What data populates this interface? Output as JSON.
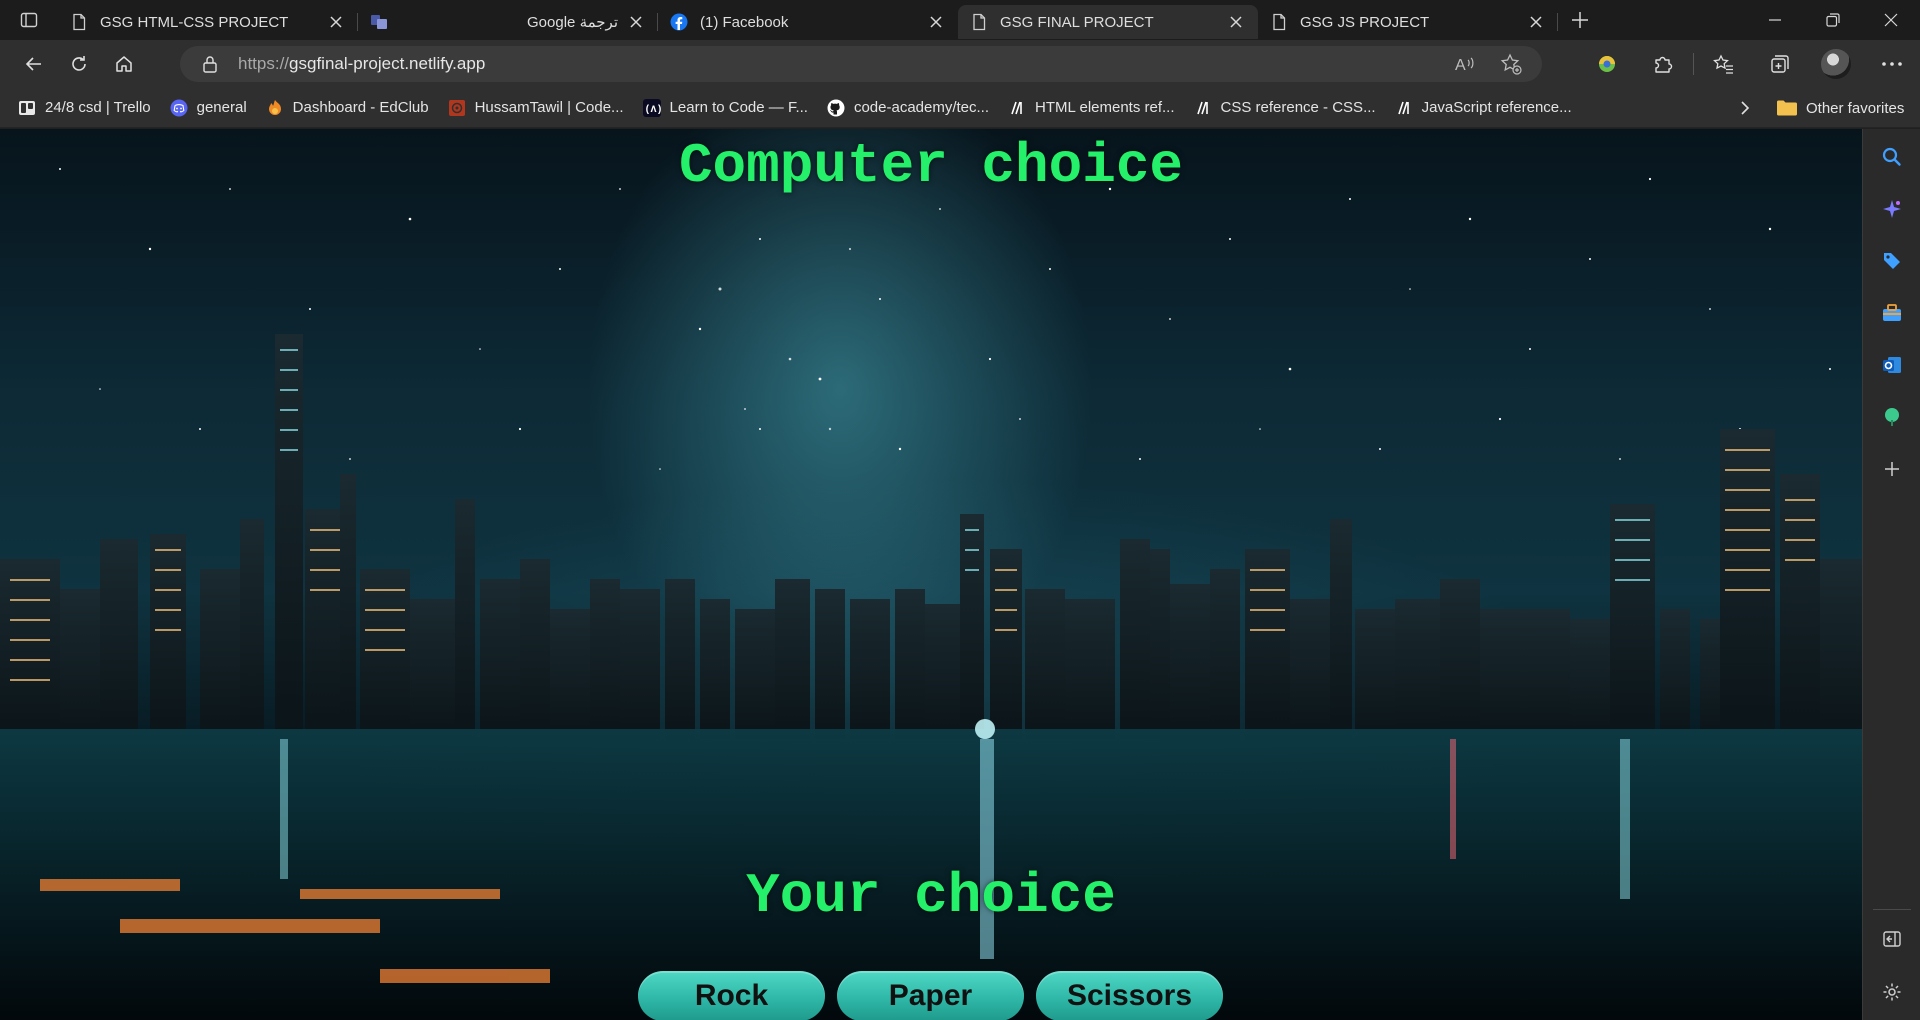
{
  "browser": {
    "tabs": [
      {
        "title": "GSG HTML-CSS PROJECT",
        "icon": "page-icon",
        "active": false
      },
      {
        "title": "Google ترجمة",
        "icon": "translate-icon",
        "active": false
      },
      {
        "title": "(1) Facebook",
        "icon": "facebook-icon",
        "active": false
      },
      {
        "title": "GSG FINAL PROJECT",
        "icon": "page-icon",
        "active": true
      },
      {
        "title": "GSG JS PROJECT",
        "icon": "page-icon",
        "active": false
      }
    ],
    "address": {
      "scheme": "https://",
      "host": "gsgfinal-project.netlify.app"
    },
    "favorites": [
      {
        "label": "24/8 csd | Trello",
        "icon": "trello-icon",
        "color": "#e8e8e8"
      },
      {
        "label": "general",
        "icon": "discord-icon",
        "color": "#5865f2"
      },
      {
        "label": "Dashboard - EdClub",
        "icon": "edclub-icon",
        "color": "#f08a24"
      },
      {
        "label": "HussamTawil | Code...",
        "icon": "codewars-icon",
        "color": "#b1361e"
      },
      {
        "label": "Learn to Code — F...",
        "icon": "freecodecamp-icon",
        "color": "#ffffff"
      },
      {
        "label": "code-academy/tec...",
        "icon": "github-icon",
        "color": "#ffffff"
      },
      {
        "label": "HTML elements ref...",
        "icon": "mdn-icon",
        "color": "#ffffff"
      },
      {
        "label": "CSS reference - CSS...",
        "icon": "mdn-icon",
        "color": "#ffffff"
      },
      {
        "label": "JavaScript reference...",
        "icon": "mdn-icon",
        "color": "#ffffff"
      }
    ],
    "other_favorites": "Other favorites"
  },
  "page": {
    "computer_heading": "Computer choice",
    "your_heading": "Your choice",
    "choices": [
      "Rock",
      "Paper",
      "Scissors"
    ],
    "accent_color": "#25f06a",
    "button_color": "#3cc8b6"
  }
}
